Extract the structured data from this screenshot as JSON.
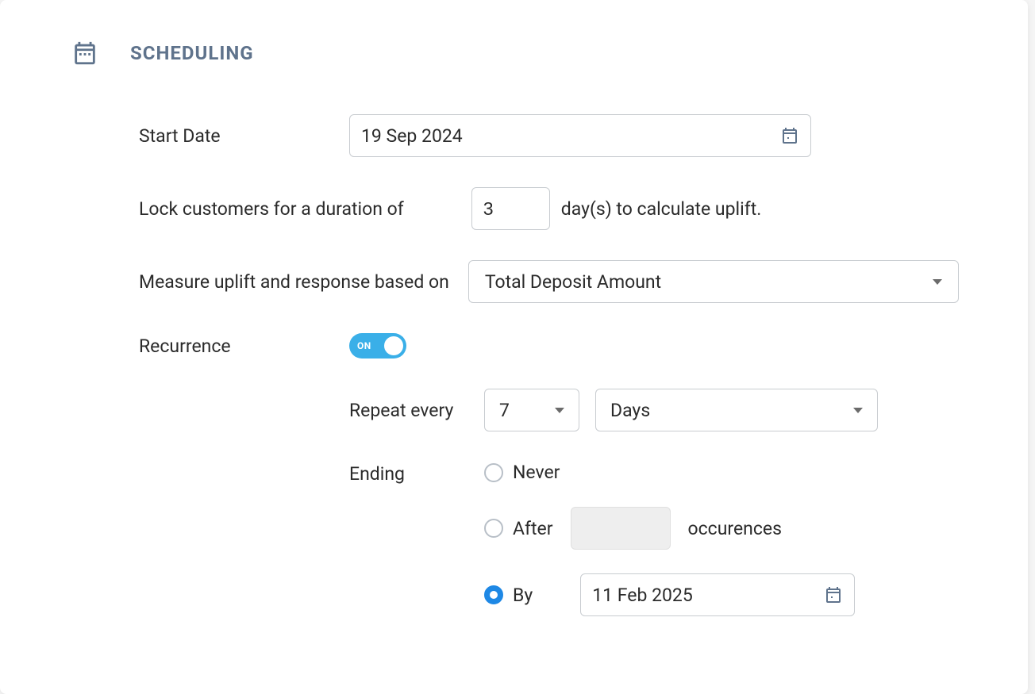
{
  "section": {
    "title": "SCHEDULING"
  },
  "start_date": {
    "label": "Start Date",
    "value": "19 Sep 2024"
  },
  "lock": {
    "prefix": "Lock customers for a duration of",
    "value": "3",
    "suffix": "day(s) to calculate uplift."
  },
  "uplift": {
    "label": "Measure uplift and response based on",
    "value": "Total Deposit Amount"
  },
  "recurrence": {
    "label": "Recurrence",
    "toggle_text": "ON"
  },
  "repeat": {
    "label": "Repeat every",
    "count": "7",
    "unit": "Days"
  },
  "ending": {
    "label": "Ending",
    "never": "Never",
    "after": "After",
    "occurrences_suffix": "occurences",
    "by": "By",
    "by_date": "11 Feb 2025",
    "selected": "by"
  }
}
